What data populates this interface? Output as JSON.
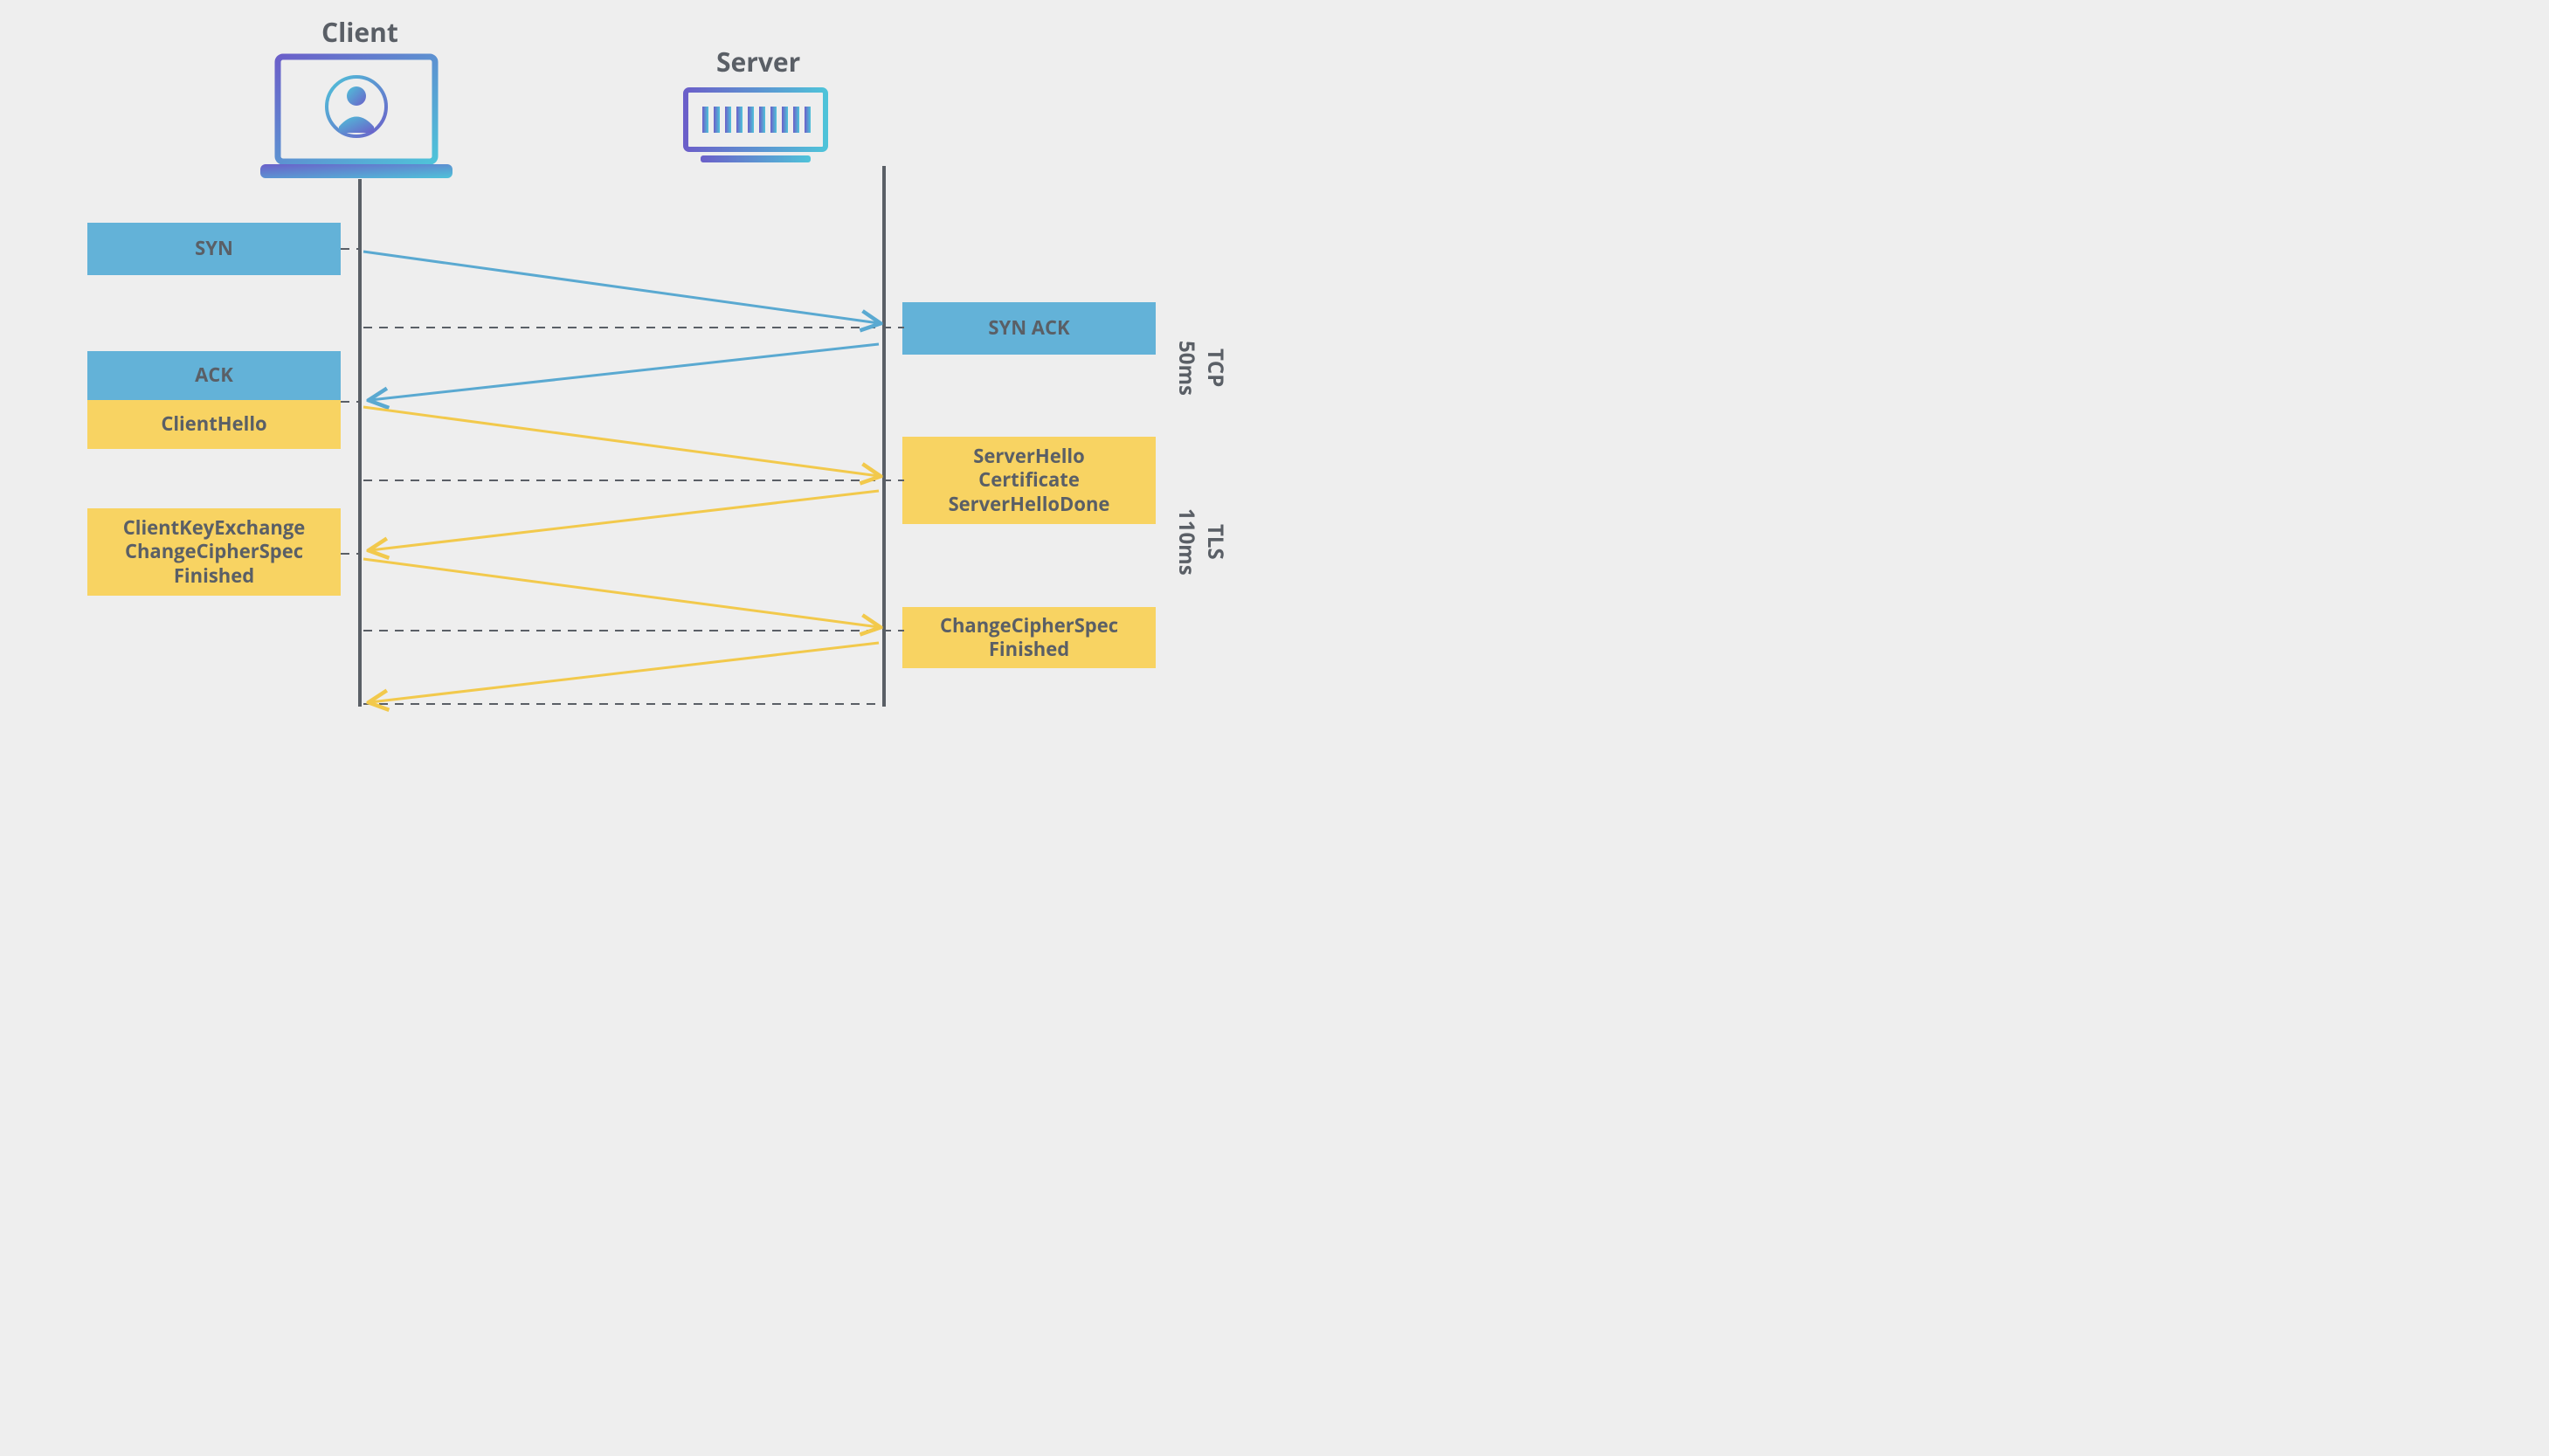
{
  "titles": {
    "client": "Client",
    "server": "Server"
  },
  "client_msgs": {
    "syn": "SYN",
    "ack": "ACK",
    "client_hello": "ClientHello",
    "ckx_line1": "ClientKeyExchange",
    "ckx_line2": "ChangeCipherSpec",
    "ckx_line3": "Finished"
  },
  "server_msgs": {
    "synack": "SYN ACK",
    "sh_line1": "ServerHello",
    "sh_line2": "Certificate",
    "sh_line3": "ServerHelloDone",
    "ccs_line1": "ChangeCipherSpec",
    "ccs_line2": "Finished"
  },
  "phases": {
    "tcp_name": "TCP",
    "tcp_time": "50ms",
    "tls_name": "TLS",
    "tls_time": "110ms"
  },
  "colors": {
    "tcp_box": "#63b2d8",
    "tls_box": "#f8d362",
    "arrow_blue": "#5aa9d1",
    "arrow_yellow": "#f2c94c",
    "text": "#5a5f66"
  }
}
